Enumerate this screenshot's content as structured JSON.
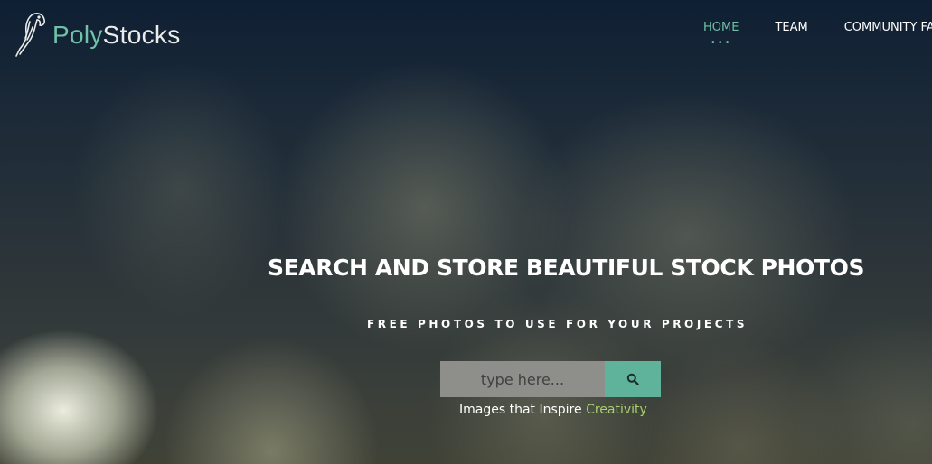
{
  "brand": {
    "name_part1": "Poly",
    "name_part2": "Stocks",
    "logo_icon": "parrot-icon"
  },
  "nav": {
    "items": [
      {
        "label": "HOME",
        "active": true
      },
      {
        "label": "TEAM",
        "active": false
      },
      {
        "label": "COMMUNITY FAV",
        "active": false
      }
    ],
    "active_indicator": "•••"
  },
  "hero": {
    "title": "SEARCH AND STORE BEAUTIFUL STOCK PHOTOS",
    "subtitle": "FREE PHOTOS TO USE FOR YOUR PROJECTS"
  },
  "search": {
    "placeholder": "type here...",
    "value": "",
    "button_icon": "search-icon"
  },
  "tagline": {
    "text": "Images that Inspire",
    "accent": "Creativity"
  },
  "colors": {
    "accent_teal": "#6fc2a8",
    "button_teal": "#5fb39a",
    "accent_green": "#a9cf6e",
    "input_bg": "#8e8f8b"
  }
}
